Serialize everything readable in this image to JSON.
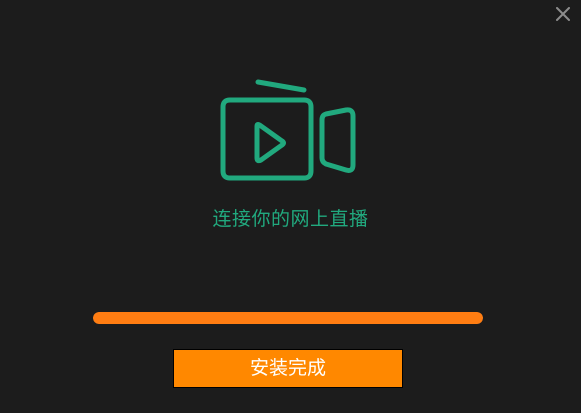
{
  "app": {
    "tagline": "连接你的网上直播",
    "finish_button_label": "安装完成",
    "progress_fraction": 1.0
  },
  "icons": {
    "close": "close-icon",
    "logo": "video-camera-play-icon"
  },
  "colors": {
    "background": "#1c1c1c",
    "accent_green": "#21a97e",
    "progress_orange": "#ff7d12",
    "button_orange": "#ff8800",
    "close_gray": "#8c8c8c",
    "button_text": "#ffffff"
  }
}
